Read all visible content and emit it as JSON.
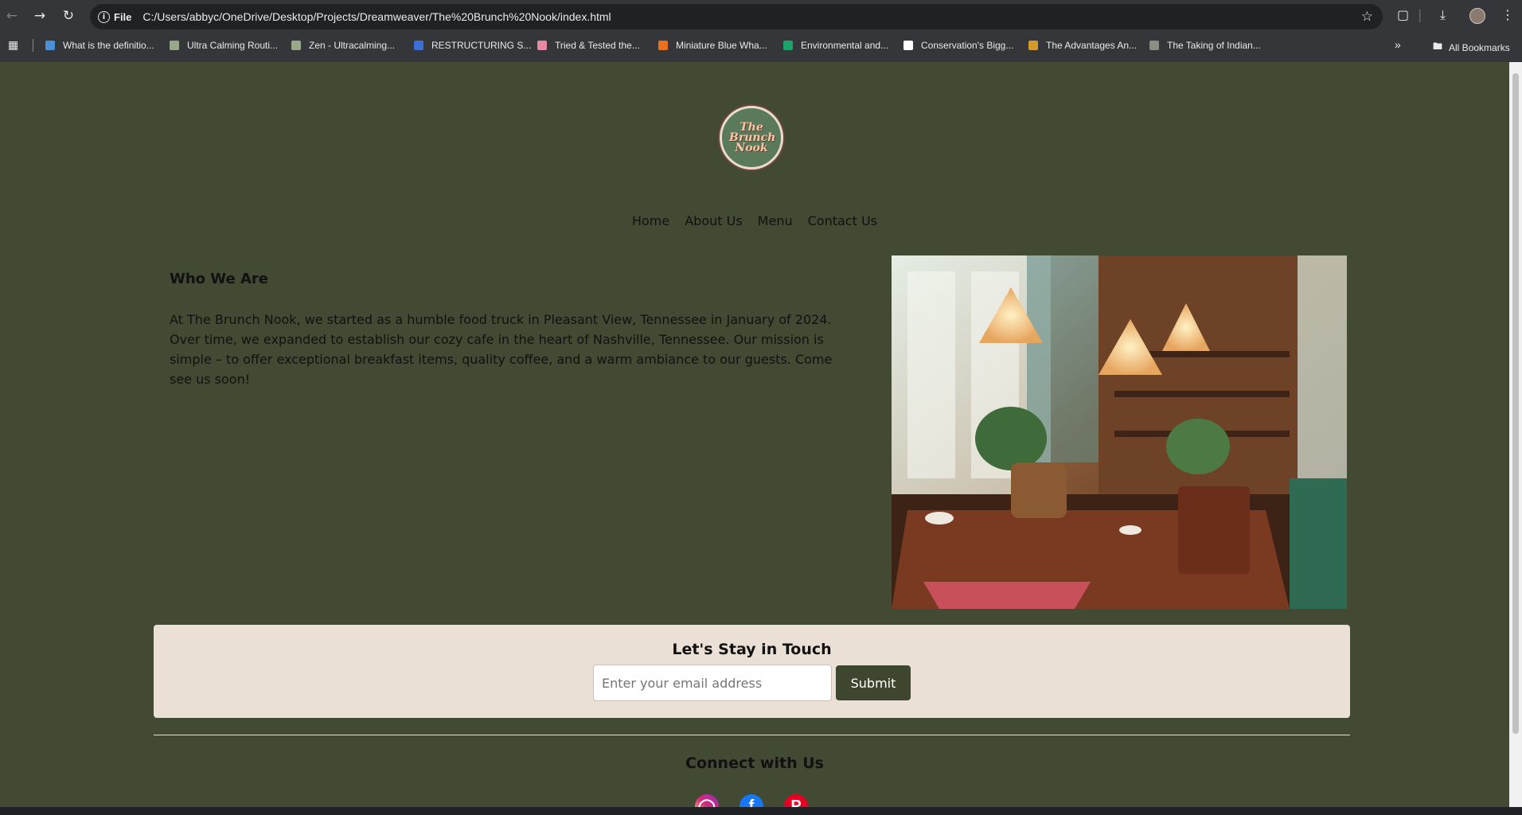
{
  "browser": {
    "address_prefix": "File",
    "url": "C:/Users/abbyc/OneDrive/Desktop/Projects/Dreamweaver/The%20Brunch%20Nook/index.html",
    "bookmarks": [
      {
        "label": "What is the definitio...",
        "color": "#4a90d9"
      },
      {
        "label": "Ultra Calming Routi...",
        "color": "#9aa88a"
      },
      {
        "label": "Zen - Ultracalming...",
        "color": "#9aa88a"
      },
      {
        "label": "RESTRUCTURING S...",
        "color": "#3d6fd6"
      },
      {
        "label": "Tried & Tested the...",
        "color": "#e58aa2"
      },
      {
        "label": "Miniature Blue Wha...",
        "color": "#e8711a"
      },
      {
        "label": "Environmental and...",
        "color": "#1aa36b"
      },
      {
        "label": "Conservation's Bigg...",
        "color": "#ffffff"
      },
      {
        "label": "The Advantages An...",
        "color": "#d49a2a"
      },
      {
        "label": "The Taking of Indian...",
        "color": "#8a8f86"
      }
    ],
    "all_bookmarks": "All Bookmarks"
  },
  "site": {
    "logo_text": "The Brunch Nook",
    "nav": [
      "Home",
      "About Us",
      "Menu",
      "Contact Us"
    ],
    "who_title": "Who We Are",
    "who_text": "At The Brunch Nook, we started as a humble food truck in Pleasant View, Tennessee in January of 2024. Over time, we expanded to establish our cozy cafe in the heart of Nashville, Tennessee. Our mission is simple – to offer exceptional breakfast items, quality coffee, and a warm ambiance to our guests. Come see us soon!",
    "stay_title": "Let's Stay in Touch",
    "email_placeholder": "Enter your email address",
    "submit_label": "Submit",
    "connect_title": "Connect with Us",
    "social": [
      {
        "name": "instagram-icon",
        "color": "#c13584"
      },
      {
        "name": "facebook-icon",
        "color": "#1877f2"
      },
      {
        "name": "pinterest-icon",
        "color": "#e60023"
      }
    ]
  }
}
